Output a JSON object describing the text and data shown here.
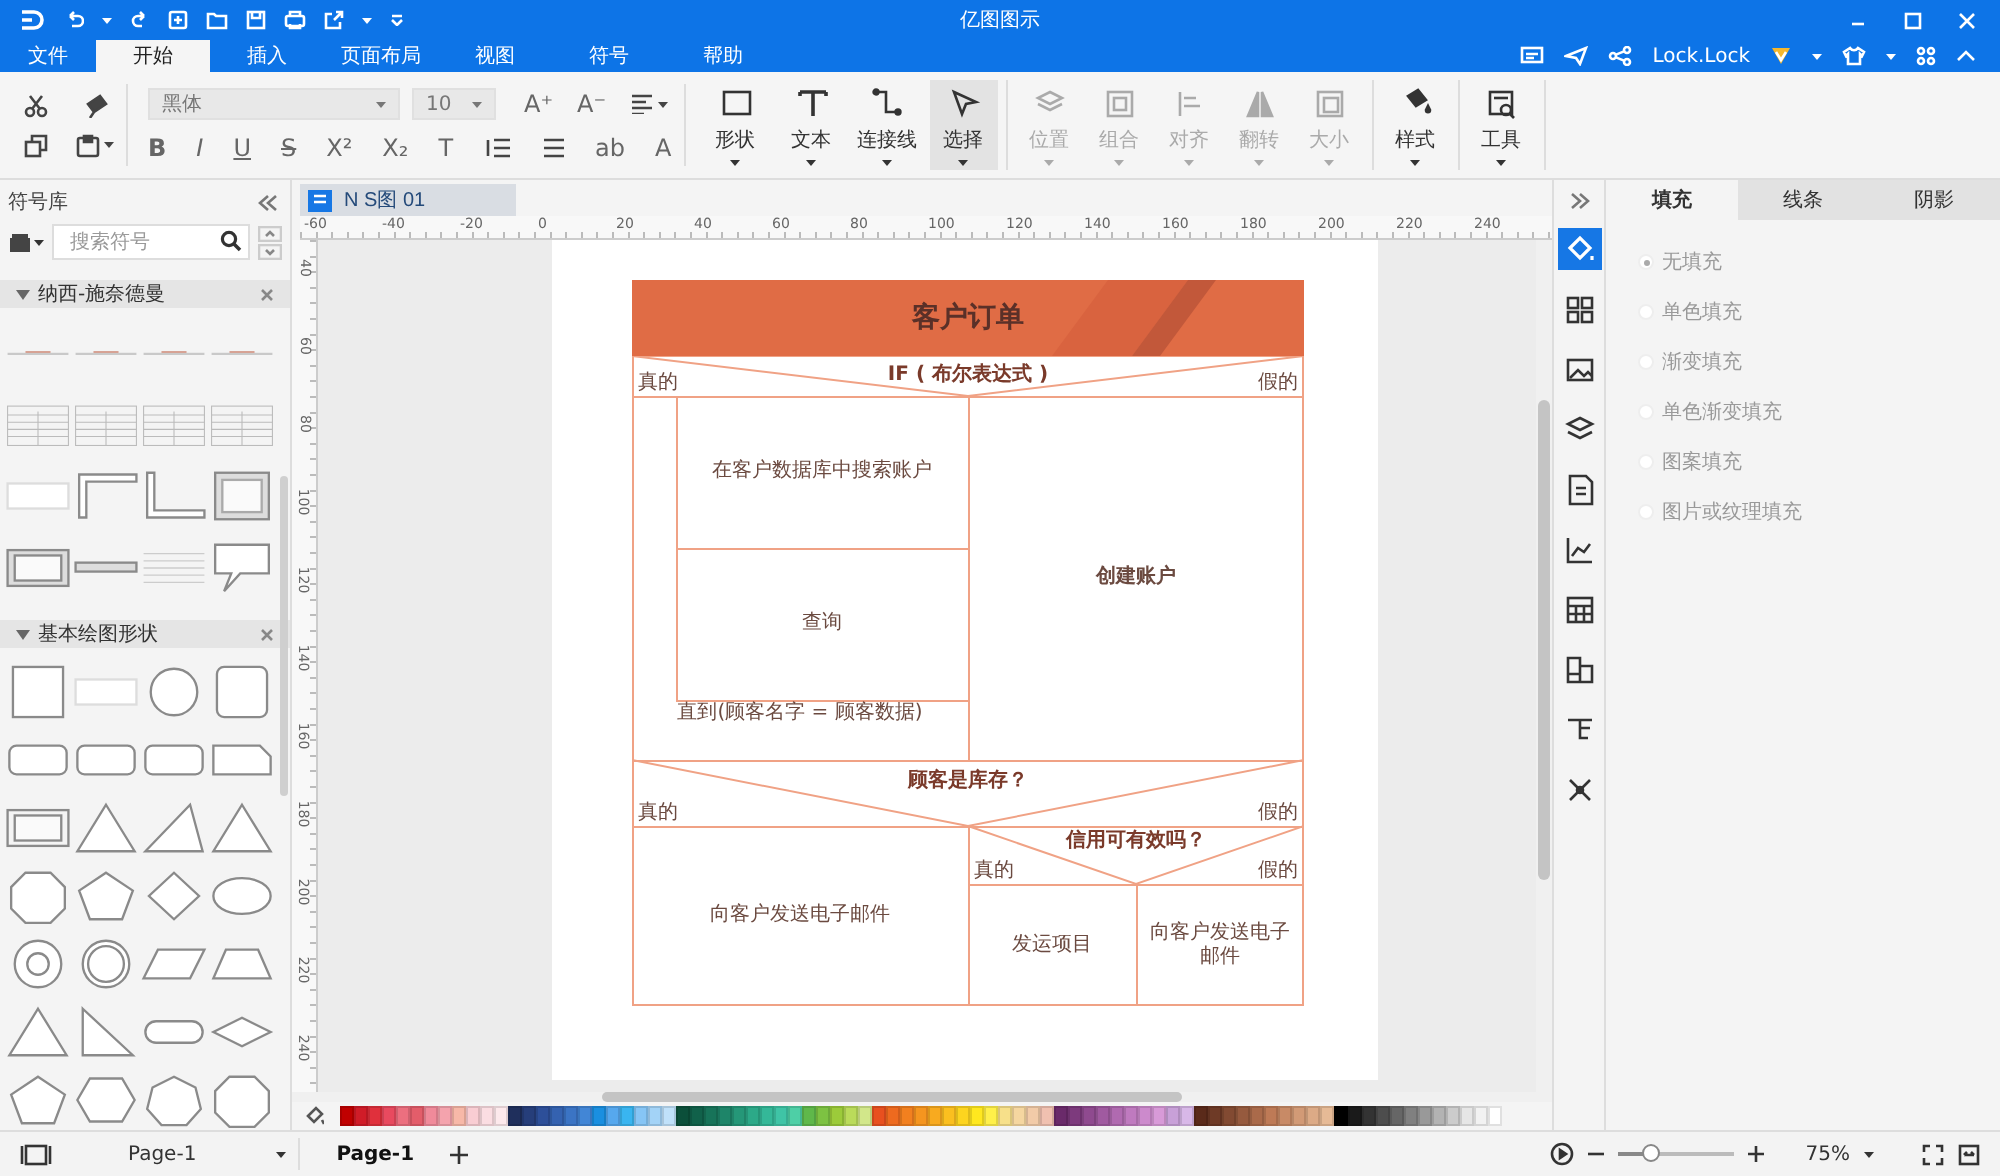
{
  "window": {
    "title": "亿图图示"
  },
  "menu_tabs": [
    {
      "label": "文件",
      "selected": false
    },
    {
      "label": "开始",
      "selected": true
    },
    {
      "label": "插入",
      "selected": false
    },
    {
      "label": "页面布局",
      "selected": false
    },
    {
      "label": "视图",
      "selected": false
    },
    {
      "label": "符号",
      "selected": false
    },
    {
      "label": "帮助",
      "selected": false
    }
  ],
  "account": {
    "name": "Lock.Lock"
  },
  "ribbon": {
    "font": "黑体",
    "size": "10",
    "size_buttons": [
      "A⁺",
      "A⁻"
    ],
    "format_buttons": [
      "B",
      "I",
      "U",
      "S",
      "X²",
      "X₂",
      "T",
      "ab",
      "A"
    ],
    "tools": [
      {
        "label": "形状",
        "selected": false
      },
      {
        "label": "文本",
        "selected": false
      },
      {
        "label": "连接线",
        "selected": false
      },
      {
        "label": "选择",
        "selected": true
      }
    ],
    "arrange": [
      {
        "label": "位置",
        "disabled": true
      },
      {
        "label": "组合",
        "disabled": true
      },
      {
        "label": "对齐",
        "disabled": true
      },
      {
        "label": "翻转",
        "disabled": true
      },
      {
        "label": "大小",
        "disabled": true
      }
    ],
    "extra": [
      {
        "label": "样式"
      },
      {
        "label": "工具"
      }
    ]
  },
  "symbol_library": {
    "title": "符号库",
    "search": {
      "placeholder": "搜索符号"
    },
    "sections": [
      {
        "title": "纳西-施奈德曼",
        "expanded": true
      },
      {
        "title": "基本绘图形状",
        "expanded": true
      }
    ]
  },
  "document_tab": {
    "label": "N S图 01"
  },
  "top_ruler": [
    "-60",
    "-40",
    "-20",
    "0",
    "20",
    "40",
    "60",
    "80",
    "100",
    "120",
    "140",
    "160",
    "180",
    "200",
    "220",
    "240"
  ],
  "left_ruler": [
    "40",
    "60",
    "80",
    "100",
    "120",
    "140",
    "160",
    "180",
    "200",
    "220",
    "240"
  ],
  "diagram": {
    "title": "客户订单",
    "decision_1": {
      "condition": "IF ( 布尔表达式 )",
      "true_label": "真的",
      "false_label": "假的"
    },
    "loop": {
      "steps": [
        "在客户数据库中搜索账户",
        "查询"
      ],
      "until": "直到(顾客名字 = 顾客数据)"
    },
    "else_step": "创建账户",
    "decision_2": {
      "condition": "顾客是库存？",
      "true_label": "真的",
      "false_label": "假的"
    },
    "true_step_2": "向客户发送电子邮件",
    "decision_3": {
      "condition": "信用可有效吗？",
      "true_label": "真的",
      "false_label": "假的"
    },
    "true_step_3": "发运项目",
    "false_step_3": "向客户发送电子邮件"
  },
  "palette": [
    {
      "color": "#c00000"
    },
    {
      "color": "#d01c28"
    },
    {
      "color": "#e0303c"
    },
    {
      "color": "#e84a5f"
    },
    {
      "color": "#ec6f7f"
    },
    {
      "color": "#e35d6a"
    },
    {
      "color": "#f08a9a"
    },
    {
      "color": "#f4a3ad"
    },
    {
      "color": "#f7b8a8"
    },
    {
      "color": "#f9cdd3"
    },
    {
      "color": "#fbdde2"
    },
    {
      "color": "#fde9ec"
    },
    {
      "color": "#1f2f5c"
    },
    {
      "color": "#263e7a"
    },
    {
      "color": "#2d4f99"
    },
    {
      "color": "#3462b0"
    },
    {
      "color": "#3b74c4"
    },
    {
      "color": "#4286d6"
    },
    {
      "color": "#1a8fe0"
    },
    {
      "color": "#56a8ee"
    },
    {
      "color": "#39b5f0"
    },
    {
      "color": "#86c5f5"
    },
    {
      "color": "#a3d3f7"
    },
    {
      "color": "#c0e1fa"
    },
    {
      "color": "#0b4f3a"
    },
    {
      "color": "#11614a"
    },
    {
      "color": "#177359"
    },
    {
      "color": "#1e8569"
    },
    {
      "color": "#259778"
    },
    {
      "color": "#2ca988"
    },
    {
      "color": "#34b898"
    },
    {
      "color": "#3fc4a6"
    },
    {
      "color": "#4ecfa6"
    },
    {
      "color": "#5fb84a"
    },
    {
      "color": "#7dc242"
    },
    {
      "color": "#9ccb3a"
    },
    {
      "color": "#badb5a"
    },
    {
      "color": "#d2e78a"
    },
    {
      "color": "#e8501f"
    },
    {
      "color": "#ee6a1f"
    },
    {
      "color": "#f2801f"
    },
    {
      "color": "#f5951f"
    },
    {
      "color": "#f8aa1f"
    },
    {
      "color": "#fbbf1f"
    },
    {
      "color": "#fdd41f"
    },
    {
      "color": "#ffe81f"
    },
    {
      "color": "#fff04a"
    },
    {
      "color": "#f7e08a"
    },
    {
      "color": "#f5d6a0"
    },
    {
      "color": "#f2cba8"
    },
    {
      "color": "#f0c0b0"
    },
    {
      "color": "#6a2a6a"
    },
    {
      "color": "#7d3a7d"
    },
    {
      "color": "#8f4a8f"
    },
    {
      "color": "#a05aa0"
    },
    {
      "color": "#b06ab0"
    },
    {
      "color": "#bf7abf"
    },
    {
      "color": "#cc8acc"
    },
    {
      "color": "#d89ad8"
    },
    {
      "color": "#c8a0d8"
    },
    {
      "color": "#d8b8e8"
    },
    {
      "color": "#5a2a1a"
    },
    {
      "color": "#6e3a26"
    },
    {
      "color": "#824a32"
    },
    {
      "color": "#965a3e"
    },
    {
      "color": "#aa6a4a"
    },
    {
      "color": "#be7a56"
    },
    {
      "color": "#c88a66"
    },
    {
      "color": "#d29a76"
    },
    {
      "color": "#dcaa86"
    },
    {
      "color": "#e6ba96"
    },
    {
      "color": "#000000"
    },
    {
      "color": "#1a1a1a"
    },
    {
      "color": "#333333"
    },
    {
      "color": "#4d4d4d"
    },
    {
      "color": "#666666"
    },
    {
      "color": "#808080"
    },
    {
      "color": "#999999"
    },
    {
      "color": "#b3b3b3"
    },
    {
      "color": "#cccccc"
    },
    {
      "color": "#e6e6e6"
    },
    {
      "color": "#f2f2f2"
    },
    {
      "color": "#ffffff"
    }
  ],
  "properties_panel": {
    "tabs": [
      {
        "label": "填充",
        "selected": true
      },
      {
        "label": "线条",
        "selected": false
      },
      {
        "label": "阴影",
        "selected": false
      }
    ],
    "options": [
      {
        "label": "无填充",
        "selected": true
      },
      {
        "label": "单色填充",
        "selected": false
      },
      {
        "label": "渐变填充",
        "selected": false
      },
      {
        "label": "单色渐变填充",
        "selected": false
      },
      {
        "label": "图案填充",
        "selected": false
      },
      {
        "label": "图片或纹理填充",
        "selected": false
      }
    ],
    "side_icons": [
      {
        "selected": true
      },
      {
        "selected": false
      },
      {
        "selected": false
      },
      {
        "selected": false
      },
      {
        "selected": false
      },
      {
        "selected": false
      },
      {
        "selected": false
      },
      {
        "selected": false
      },
      {
        "selected": false
      },
      {
        "selected": false
      }
    ]
  },
  "status_bar": {
    "page_select": "Page-1",
    "pages": [
      {
        "label": "Page-1",
        "selected": true
      }
    ],
    "zoom": {
      "level": 0.28,
      "reading": "75%"
    }
  }
}
